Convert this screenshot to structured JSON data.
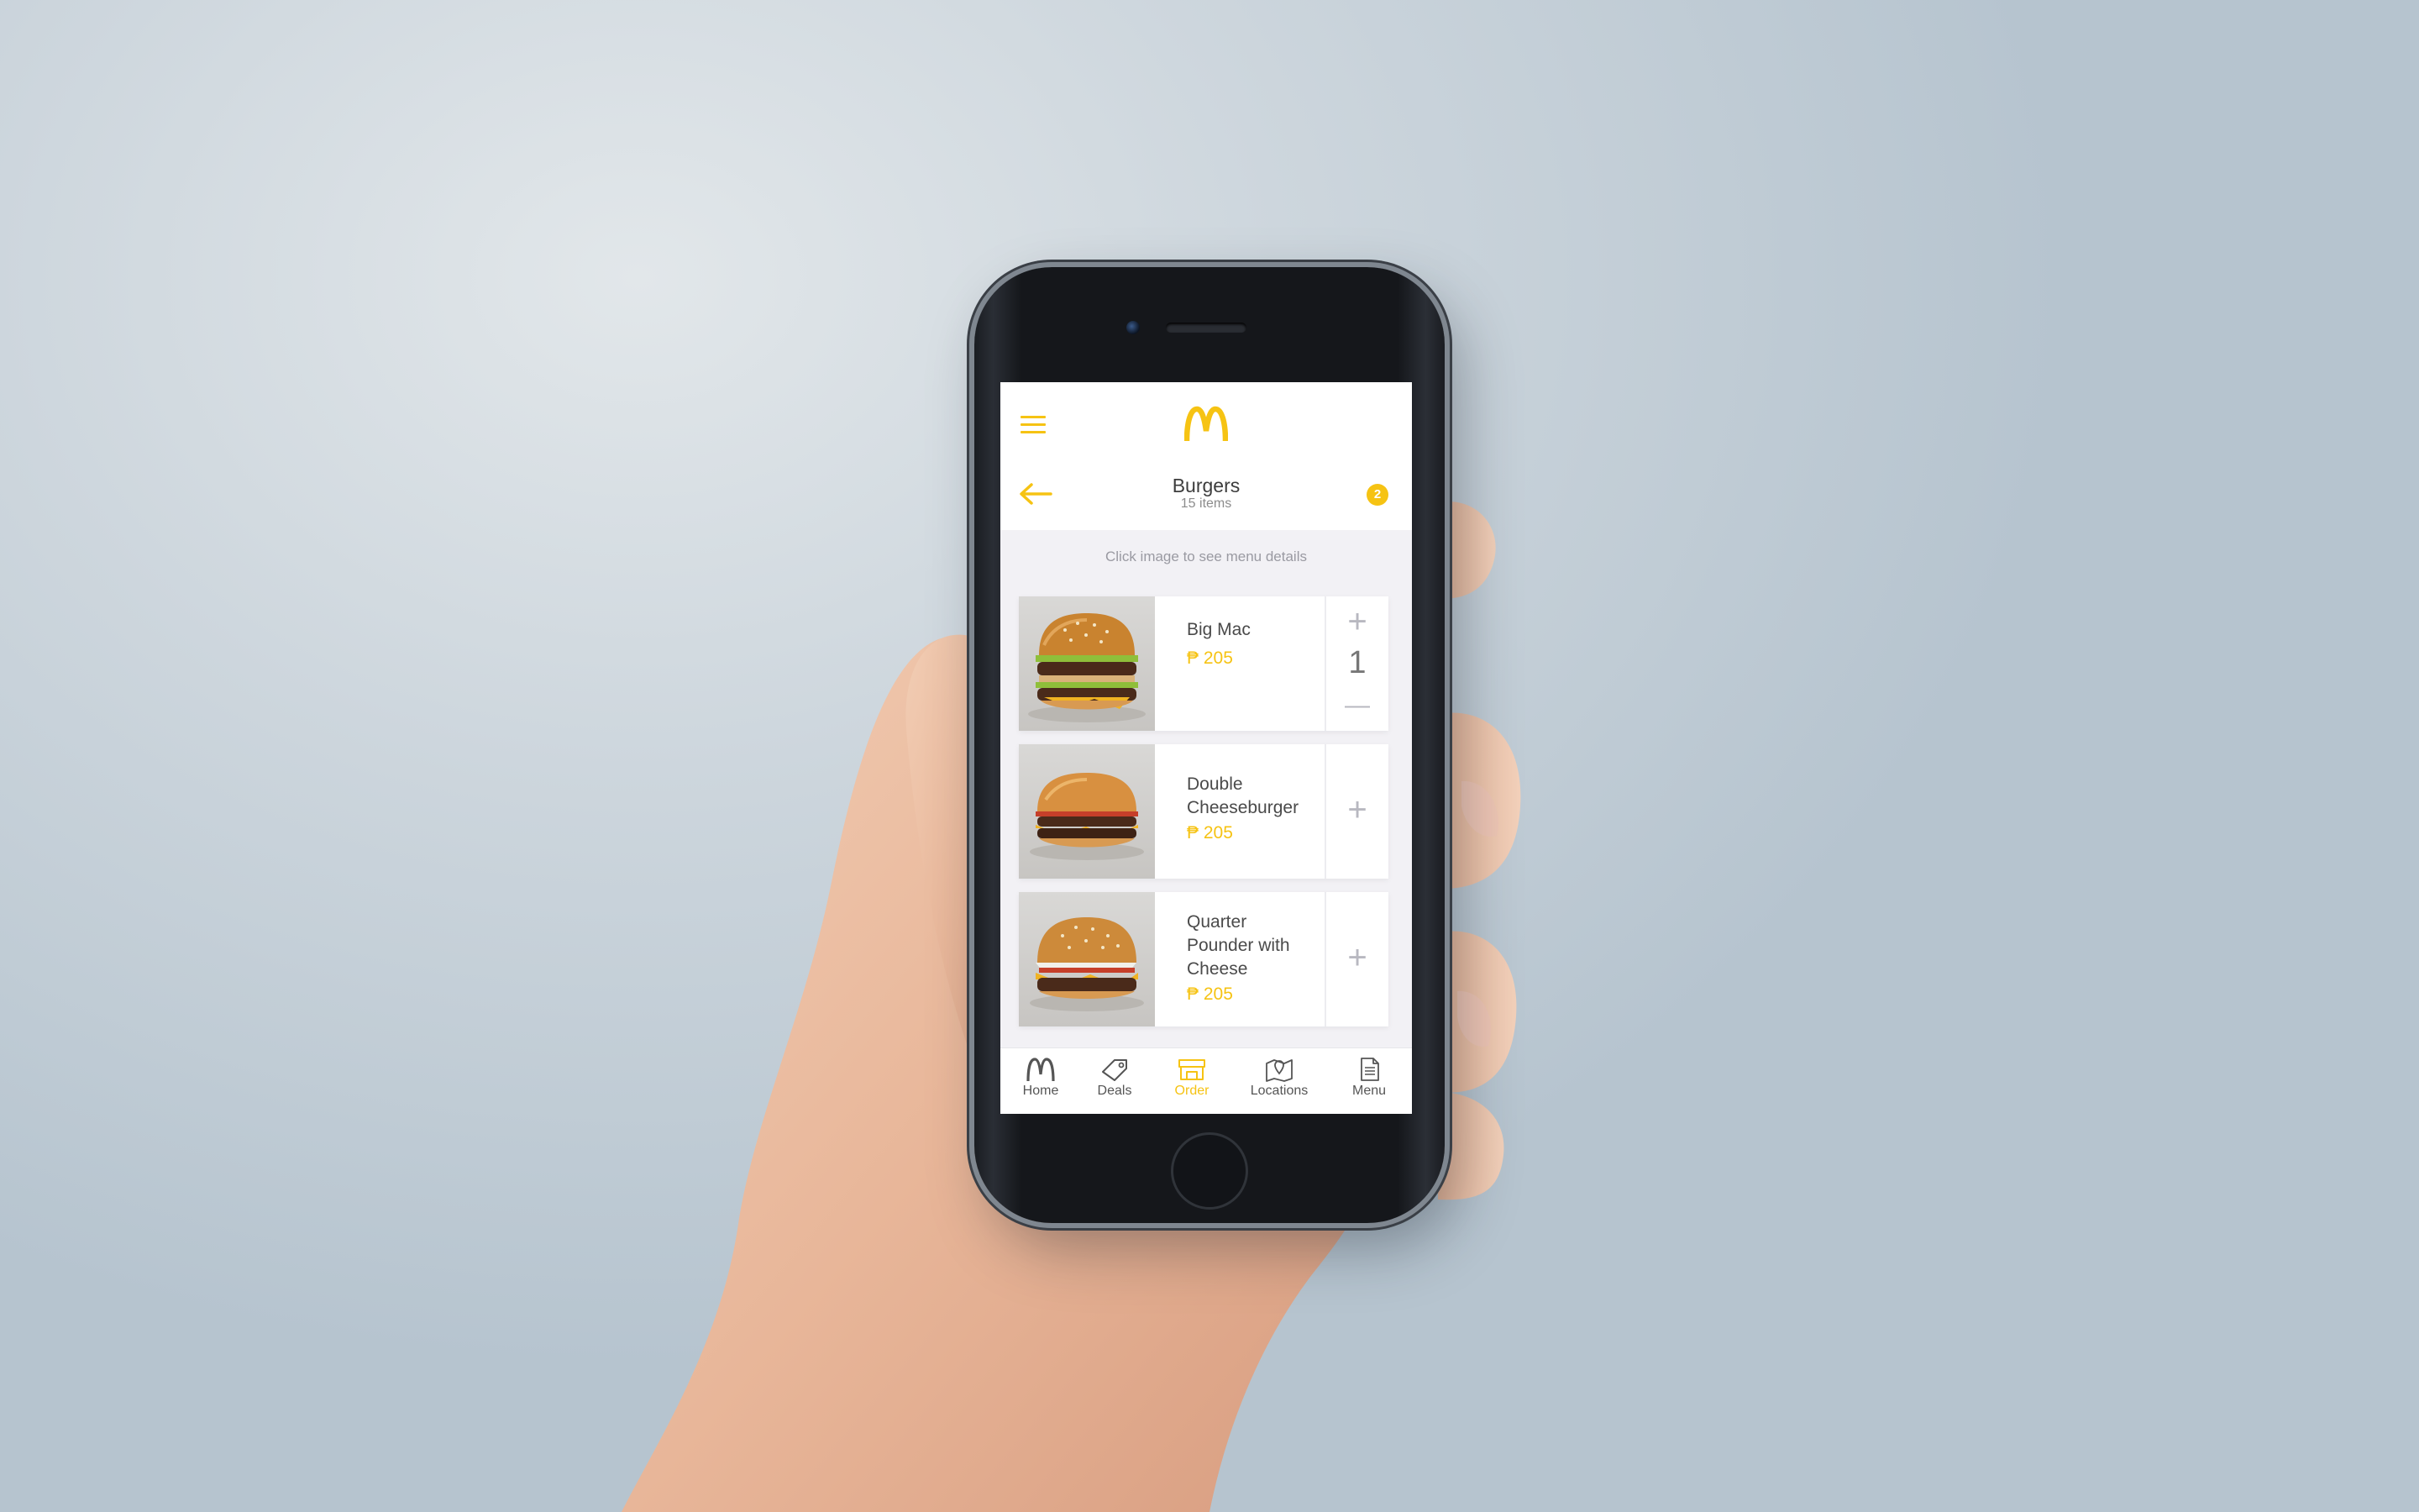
{
  "app": {
    "brand_color": "#f6c313",
    "logo": "golden-arches-logo"
  },
  "header": {
    "menu_icon": "hamburger-icon",
    "back_icon": "back-arrow-icon",
    "title": "Burgers",
    "subtitle": "15 items",
    "cart_count": "2"
  },
  "hint": "Click image to see menu details",
  "items": [
    {
      "name_lines": [
        "Big Mac"
      ],
      "price": "₱ 205",
      "quantity": "1",
      "plus": "+",
      "minus": "—"
    },
    {
      "name_lines": [
        "Double",
        "Cheeseburger"
      ],
      "price": "₱ 205",
      "plus": "+"
    },
    {
      "name_lines": [
        "Quarter",
        "Pounder with",
        "Cheese"
      ],
      "price": "₱ 205",
      "plus": "+"
    }
  ],
  "tabs": [
    {
      "label": "Home",
      "icon": "arches-icon",
      "active": false
    },
    {
      "label": "Deals",
      "icon": "tag-icon",
      "active": false
    },
    {
      "label": "Order",
      "icon": "store-icon",
      "active": true
    },
    {
      "label": "Locations",
      "icon": "map-pin-icon",
      "active": false
    },
    {
      "label": "Menu",
      "icon": "document-icon",
      "active": false
    }
  ]
}
